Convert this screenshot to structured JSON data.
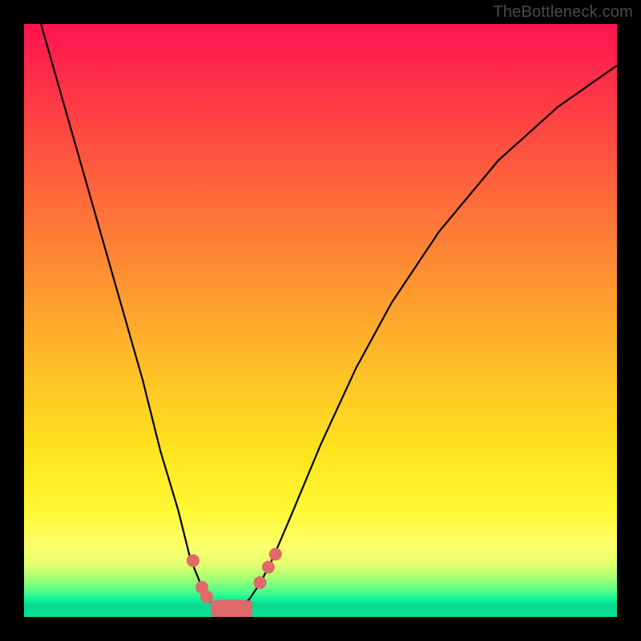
{
  "attribution": "TheBottleneck.com",
  "colors": {
    "frame": "#000000",
    "gradient_top": "#ff1450",
    "gradient_mid": "#ffe41e",
    "gradient_green": "#10f39a",
    "curve": "#000000",
    "marker": "#e06a6a"
  },
  "chart_data": {
    "type": "line",
    "title": "",
    "xlabel": "",
    "ylabel": "",
    "xlim": [
      0,
      100
    ],
    "ylim": [
      0,
      100
    ],
    "note": "No numeric axes or tick labels are rendered in the image; x/y are normalized plot percentages. The curve depicts a V-shaped bottleneck plot with a flat minimum.",
    "series": [
      {
        "name": "bottleneck-curve",
        "x": [
          0,
          4,
          8,
          12,
          16,
          20,
          23,
          26,
          28,
          30,
          31.5,
          33,
          34,
          35,
          36,
          38,
          40,
          42,
          45,
          50,
          56,
          62,
          70,
          80,
          90,
          100
        ],
        "y": [
          110,
          96,
          82,
          68,
          54,
          40,
          28,
          18,
          10,
          5,
          2.5,
          1.5,
          1.2,
          1.2,
          1.5,
          3,
          6,
          10,
          17,
          29,
          42,
          53,
          65,
          77,
          86,
          93
        ]
      }
    ],
    "markers": [
      {
        "x": 28.5,
        "y": 9.5
      },
      {
        "x": 30.0,
        "y": 5.0
      },
      {
        "x": 30.8,
        "y": 3.4
      },
      {
        "x": 39.8,
        "y": 5.8
      },
      {
        "x": 41.2,
        "y": 8.4
      },
      {
        "x": 42.4,
        "y": 10.6
      }
    ],
    "flat_min_lobe": {
      "x0": 31.5,
      "x1": 38.5,
      "y": 1.4,
      "thickness": 2.6
    }
  }
}
